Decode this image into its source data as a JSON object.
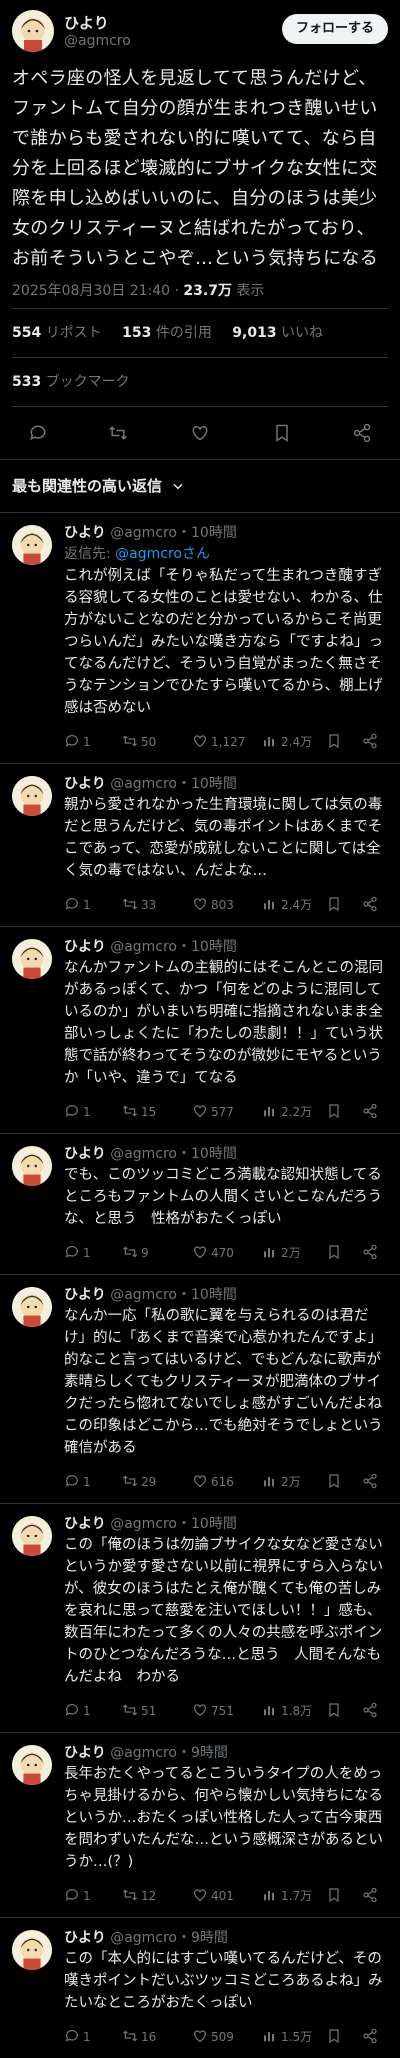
{
  "author": {
    "name": "ひより",
    "handle": "@agmcro",
    "follow_label": "フォローする"
  },
  "tweet": {
    "text": "オペラ座の怪人を見返してて思うんだけど、ファントムて自分の顔が生まれつき醜いせいで誰からも愛されない的に嘆いてて、なら自分を上回るほど壊滅的にブサイクな女性に交際を申し込めばいいのに、自分のほうは美少女のクリスティーヌと結ばれたがっており、お前そういうとこやぞ…という気持ちになる",
    "timestamp": "2025年08月30日 21:40",
    "views": "23.7万",
    "views_label": "表示",
    "sep": " · "
  },
  "stats": {
    "reposts": "554",
    "reposts_label": "リポスト",
    "quotes": "153",
    "quotes_label": "件の引用",
    "likes": "9,013",
    "likes_label": "いいね",
    "bookmarks": "533",
    "bookmarks_label": "ブックマーク"
  },
  "icons": [
    "reply-icon",
    "repost-icon",
    "like-icon",
    "bookmark-icon",
    "share-icon",
    "views-icon"
  ],
  "colors": {
    "background": "#000000",
    "text": "#e7e9ea",
    "muted": "#71767b",
    "link": "#1d9bf0"
  },
  "sort_label": "最も関連性の高い返信",
  "replies": [
    {
      "name": "ひより",
      "meta": "@agmcro・10時間",
      "reply_to_prefix": "返信先: ",
      "reply_to_link": "@agmcroさん",
      "text": "これが例えば「そりゃ私だって生まれつき醜すぎる容貌してる女性のことは愛せない、わかる、仕方がないことなのだと分かっているからこそ尚更つらいんだ」みたいな嘆き方なら「ですよね」ってなるんだけど、そういう自覚がまったく無さそうなテンションでひたすら嘆いてるから、棚上げ感は否めない",
      "replies": "1",
      "reposts": "50",
      "likes": "1,127",
      "views": "2.4万"
    },
    {
      "name": "ひより",
      "meta": "@agmcro・10時間",
      "text": "親から愛されなかった生育環境に関しては気の毒だと思うんだけど、気の毒ポイントはあくまでそこであって、恋愛が成就しないことに関しては全く気の毒ではない、んだよな…",
      "replies": "1",
      "reposts": "33",
      "likes": "803",
      "views": "2.4万"
    },
    {
      "name": "ひより",
      "meta": "@agmcro・10時間",
      "text": "なんかファントムの主観的にはそこんとこの混同があるっぽくて、かつ「何をどのように混同しているのか」がいまいち明確に指摘されないまま全部いっしょくたに「わたしの悲劇！！」ていう状態で話が終わってそうなのが微妙にモヤるというか「いや、違うで」てなる",
      "replies": "1",
      "reposts": "15",
      "likes": "577",
      "views": "2.2万"
    },
    {
      "name": "ひより",
      "meta": "@agmcro・10時間",
      "text": "でも、このツッコミどころ満載な認知状態してるところもファントムの人間くさいとこなんだろうな、と思う　性格がおたくっぽい",
      "replies": "1",
      "reposts": "9",
      "likes": "470",
      "views": "2万"
    },
    {
      "name": "ひより",
      "meta": "@agmcro・10時間",
      "text": "なんか一応「私の歌に翼を与えられるのは君だけ」的に「あくまで音楽で心惹かれたんですよ」的なこと言ってはいるけど、でもどんなに歌声が素晴らしくてもクリスティーヌが肥満体のブサイクだったら惚れてないでしょ感がすごいんだよね　この印象はどこから…でも絶対そうでしょという確信がある",
      "replies": "1",
      "reposts": "29",
      "likes": "616",
      "views": "2万"
    },
    {
      "name": "ひより",
      "meta": "@agmcro・10時間",
      "text": "この「俺のほうは勿論ブサイクな女など愛さないというか愛す愛さない以前に視界にすら入らないが、彼女のほうはたとえ俺が醜くても俺の苦しみを哀れに思って慈愛を注いでほしい！！」感も、数百年にわたって多くの人々の共感を呼ぶポイントのひとつなんだろうな…と思う　人間そんなもんだよね　わかる",
      "replies": "1",
      "reposts": "51",
      "likes": "751",
      "views": "1.8万"
    },
    {
      "name": "ひより",
      "meta": "@agmcro・9時間",
      "text": "長年おたくやってるとこういうタイプの人をめっちゃ見掛けるから、何やら懐かしい気持ちになるというか…おたくっぽい性格した人って古今東西を問わずいたんだな…という感概深さがあるというか…(？)",
      "replies": "1",
      "reposts": "12",
      "likes": "401",
      "views": "1.7万"
    },
    {
      "name": "ひより",
      "meta": "@agmcro・9時間",
      "text": "この「本人的にはすごい嘆いてるんだけど、その嘆きポイントだいぶツッコミどころあるよね」みたいなところがおたくっぽい",
      "replies": "1",
      "reposts": "16",
      "likes": "509",
      "views": "1.5万"
    }
  ]
}
